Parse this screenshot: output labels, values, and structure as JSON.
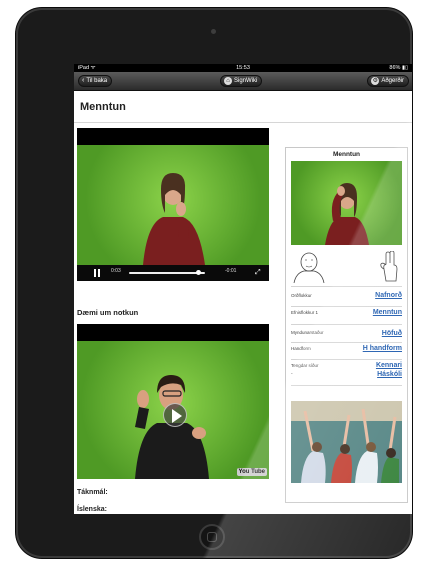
{
  "status_bar": {
    "carrier": "iPad ᯤ",
    "time": "15:53",
    "battery": "86% ▮▯"
  },
  "nav_bar": {
    "back_label": "Til baka",
    "center_label": "SignWiki",
    "actions_label": "Aðgerðir"
  },
  "page": {
    "title": "Menntun"
  },
  "main_video": {
    "elapsed": "0:03",
    "remaining": "-0:01",
    "progress_fraction": 0.92
  },
  "examples": {
    "heading": "Dæmi um notkun",
    "video_logo": "You Tube"
  },
  "labels": {
    "sign_language": "Táknmál:",
    "icelandic": "Íslenska:"
  },
  "side_panel": {
    "title": "Menntun",
    "rows": [
      {
        "key": "Orðflokkur",
        "value": "Nafnorð"
      },
      {
        "key": "Efnisflokkur 1",
        "value": "Menntun"
      },
      {
        "key": "Myndunarstaður",
        "value": "Höfuð"
      },
      {
        "key": "Handform",
        "value": "H handform"
      },
      {
        "key": "Tengdar síður",
        "value": "Kennari",
        "value2": "Háskóli",
        "cont": "-"
      }
    ]
  },
  "colors": {
    "link": "#0e4fa8",
    "green_screen": "#6cbc37",
    "nav_dark": "#2b2b2b"
  }
}
